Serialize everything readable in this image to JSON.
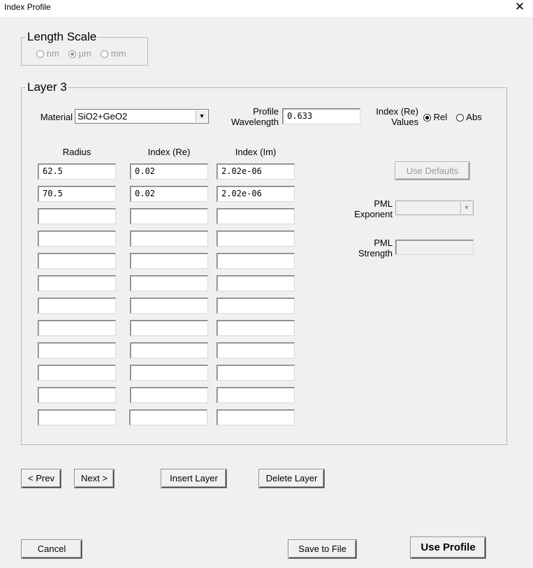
{
  "window": {
    "title": "Index Profile",
    "close_glyph": "✕"
  },
  "length_scale": {
    "legend": "Length Scale",
    "options": [
      {
        "label": "nm",
        "selected": false
      },
      {
        "label": "µm",
        "selected": true
      },
      {
        "label": "mm",
        "selected": false
      }
    ]
  },
  "layer": {
    "legend": "Layer 3",
    "material_label": "Material",
    "material_value": "SiO2+GeO2",
    "profile_label_1": "Profile",
    "profile_label_2": "Wavelength",
    "profile_value": "0.633",
    "index_values_label_1": "Index (Re)",
    "index_values_label_2": "Values",
    "rel_label": "Rel",
    "abs_label": "Abs",
    "rel_selected": true,
    "columns": [
      "Radius",
      "Index (Re)",
      "Index (Im)"
    ],
    "rows": [
      [
        "62.5",
        "0.02",
        "2.02e-06"
      ],
      [
        "70.5",
        "0.02",
        "2.02e-06"
      ],
      [
        "",
        "",
        ""
      ],
      [
        "",
        "",
        ""
      ],
      [
        "",
        "",
        ""
      ],
      [
        "",
        "",
        ""
      ],
      [
        "",
        "",
        ""
      ],
      [
        "",
        "",
        ""
      ],
      [
        "",
        "",
        ""
      ],
      [
        "",
        "",
        ""
      ],
      [
        "",
        "",
        ""
      ],
      [
        "",
        "",
        ""
      ]
    ],
    "use_defaults_label": "Use Defaults",
    "pml_exponent_label_1": "PML",
    "pml_exponent_label_2": "Exponent",
    "pml_exponent_value": "",
    "pml_strength_label_1": "PML",
    "pml_strength_label_2": "Strength",
    "pml_strength_value": ""
  },
  "nav": {
    "prev_label": "< Prev",
    "next_label": "Next >",
    "insert_label": "Insert Layer",
    "delete_label": "Delete Layer"
  },
  "footer": {
    "cancel_label": "Cancel",
    "save_label": "Save to File",
    "use_profile_label": "Use Profile"
  }
}
